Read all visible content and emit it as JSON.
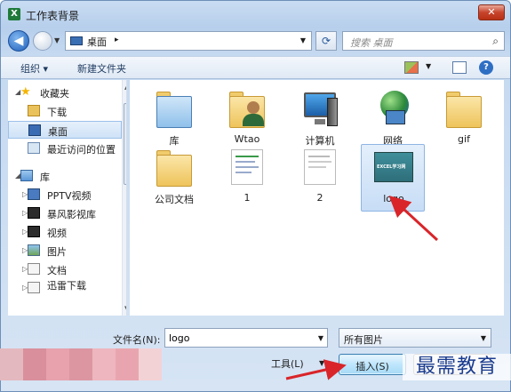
{
  "window": {
    "title": "工作表背景",
    "close_glyph": "✕",
    "app_icon_glyph": "X"
  },
  "address": {
    "current": "桌面",
    "separator": "▸",
    "search_placeholder": "搜索 桌面"
  },
  "toolbar": {
    "organize": "组织 ▾",
    "new_folder": "新建文件夹"
  },
  "navigation": {
    "items": [
      {
        "label": "收藏夹",
        "icon": "star-icon"
      },
      {
        "label": "下载",
        "icon": "downloads-folder-icon"
      },
      {
        "label": "桌面",
        "icon": "desktop-icon",
        "selected": true
      },
      {
        "label": "最近访问的位置",
        "icon": "recent-places-icon"
      },
      {
        "label": "库",
        "icon": "library-icon"
      },
      {
        "label": "PPTV视频",
        "icon": "video-library-icon"
      },
      {
        "label": "暴风影视库",
        "icon": "film-library-icon"
      },
      {
        "label": "视频",
        "icon": "videos-icon"
      },
      {
        "label": "图片",
        "icon": "pictures-icon"
      },
      {
        "label": "文档",
        "icon": "documents-icon"
      },
      {
        "label": "迅雷下载",
        "icon": "thunder-download-icon"
      }
    ]
  },
  "files": [
    {
      "label": "库",
      "icon": "library-folder-icon"
    },
    {
      "label": "Wtao",
      "icon": "user-folder-icon"
    },
    {
      "label": "计算机",
      "icon": "computer-icon"
    },
    {
      "label": "网络",
      "icon": "network-icon"
    },
    {
      "label": "gif",
      "icon": "folder-icon"
    },
    {
      "label": "公司文档",
      "icon": "folder-icon"
    },
    {
      "label": "1",
      "icon": "image-thumbnail-icon"
    },
    {
      "label": "2",
      "icon": "image-thumbnail-icon"
    },
    {
      "label": "logo",
      "icon": "logo-image-thumbnail-icon",
      "selected": true,
      "thumb_text": "EXCEL学习网"
    }
  ],
  "bottom": {
    "filename_label": "文件名(N):",
    "filename_value": "logo",
    "filetype_value": "所有图片",
    "tools_label": "工具(L)",
    "insert_label": "插入(S)"
  },
  "watermark": "最需教育",
  "colors": {
    "accent": "#3c7fb1",
    "annotation_arrow": "#d9252a",
    "watermark": "#1a3c8f"
  }
}
